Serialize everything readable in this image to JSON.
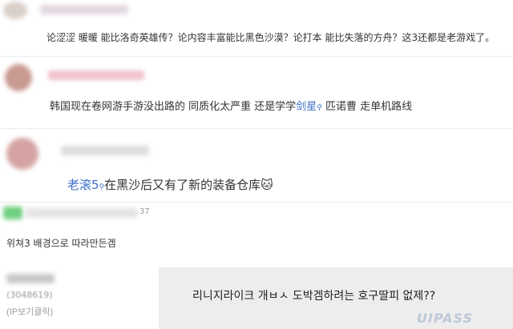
{
  "comments": [
    {
      "text": "论涩涩 暖暖 能比洛奇英雄传？论内容丰富能比黑色沙漠？论打本 能比失落的方舟？这3还都是老游戏了。"
    },
    {
      "text_before": "韩国现在卷网游手游没出路的 同质化太严重 还是学学",
      "link": "剑星",
      "text_after": " 匹诺曹 走单机路线"
    },
    {
      "mention": "老滚5",
      "text": "在黑沙后又有了新的装备仓库",
      "emoji": "🐱"
    },
    {
      "count": "37",
      "text": "위쳐3 배경으로 따라만든겜"
    },
    {
      "user_id": "(3048619)",
      "ip_link": "(IP보기클릭)",
      "text": "리니지라이크 개ㅂㅅ 도박겜하려는 호구딸피 없제??"
    }
  ],
  "watermark": "UIPASS"
}
